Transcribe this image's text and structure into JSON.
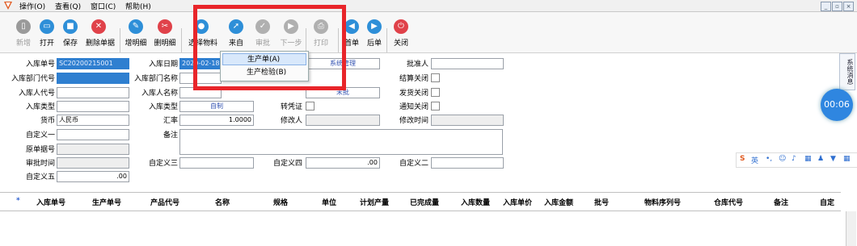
{
  "menu": {
    "items": [
      "操作(O)",
      "查看(Q)",
      "窗口(C)",
      "帮助(H)"
    ],
    "window_buttons": [
      "_",
      "▫",
      "×"
    ]
  },
  "toolbar": {
    "buttons": [
      {
        "label": "新增",
        "icon": "new-doc-icon",
        "color": "#9a9a9a",
        "disabled": true
      },
      {
        "label": "打开",
        "icon": "open-folder-icon",
        "color": "#2e8fd8",
        "disabled": false
      },
      {
        "label": "保存",
        "icon": "save-icon",
        "color": "#2e8fd8",
        "disabled": false
      },
      {
        "label": "删除单据",
        "icon": "delete-icon",
        "color": "#e0424a",
        "disabled": false
      },
      {
        "label": "增明细",
        "icon": "add-detail-icon",
        "color": "#2e8fd8",
        "disabled": false
      },
      {
        "label": "删明细",
        "icon": "remove-detail-icon",
        "color": "#e0424a",
        "disabled": false
      },
      {
        "label": "选择物料",
        "icon": "material-icon",
        "color": "#2e8fd8",
        "disabled": false
      },
      {
        "label": "来自",
        "icon": "source-icon",
        "color": "#2e8fd8",
        "disabled": false
      },
      {
        "label": "审批",
        "icon": "approve-icon",
        "color": "#b0b0b0",
        "disabled": true
      },
      {
        "label": "下一步",
        "icon": "next-step-icon",
        "color": "#b0b0b0",
        "disabled": true
      },
      {
        "label": "打印",
        "icon": "print-icon",
        "color": "#b0b0b0",
        "disabled": true
      },
      {
        "label": "首单",
        "icon": "first-record-icon",
        "color": "#2e8fd8",
        "disabled": false
      },
      {
        "label": "后单",
        "icon": "next-record-icon",
        "color": "#2e8fd8",
        "disabled": false
      },
      {
        "label": "关闭",
        "icon": "close-icon",
        "color": "#e0424a",
        "disabled": false
      }
    ]
  },
  "dropdown": {
    "items": [
      "生产单(A)",
      "生产检验(B)"
    ]
  },
  "form": {
    "labels": {
      "in_no": "入库单号",
      "dept_code": "入库部门代号",
      "person_code": "入库人代号",
      "in_type": "入库类型",
      "currency": "货币",
      "custom1": "自定义一",
      "orig_no": "原单据号",
      "approve_time": "审批时间",
      "custom5": "自定义五",
      "in_date": "入库日期",
      "dept_name": "入库部门名称",
      "person_name": "入库人名称",
      "in_type2": "入库类型",
      "rate": "汇率",
      "remark": "备注",
      "custom3": "自定义三",
      "custom4": "自定义四",
      "custom2": "自定义二",
      "status": "单据状态",
      "transfer": "转凭证",
      "modifier": "修改人",
      "approver": "批准人",
      "settle_close": "结算关闭",
      "ship_close": "发货关闭",
      "notify_close": "通知关闭",
      "modify_time": "修改时间"
    },
    "values": {
      "in_no": "SC20200215001",
      "in_date": "2020-02-18",
      "operator": "系统管理",
      "status": "未批",
      "in_type2": "自制",
      "currency": "人民币",
      "rate": "1.0000",
      "custom4": ".00",
      "custom5": ".00"
    }
  },
  "grid": {
    "marker": "*",
    "columns": [
      "入库单号",
      "生产单号",
      "产品代号",
      "名称",
      "规格",
      "单位",
      "计划产量",
      "已完成量",
      "入库数量",
      "入库单价",
      "入库金额",
      "批号",
      "物料序列号",
      "仓库代号",
      "备注",
      "自定"
    ]
  },
  "side": {
    "panel_label": "系统消息",
    "timer": "00:06",
    "ime_label": "英"
  }
}
